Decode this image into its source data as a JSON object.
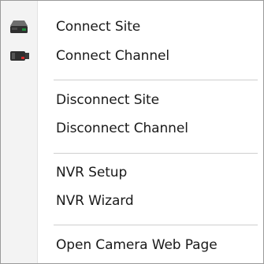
{
  "menu": {
    "items": [
      {
        "label": "Connect Site",
        "icon": "site-drive-icon"
      },
      {
        "label": "Connect Channel",
        "icon": "camera-channel-icon"
      },
      {
        "label": "Disconnect Site"
      },
      {
        "label": "Disconnect Channel"
      },
      {
        "label": "NVR Setup"
      },
      {
        "label": "NVR Wizard"
      },
      {
        "label": "Open Camera Web Page"
      }
    ]
  },
  "colors": {
    "menu_background": "#ffffff",
    "gutter_background": "#f3f3f3",
    "border": "#9a9a9a",
    "separator": "#cfcfcf",
    "text": "#1a1a1a",
    "icon_green": "#1f8a3b",
    "icon_red": "#d22b2b"
  }
}
